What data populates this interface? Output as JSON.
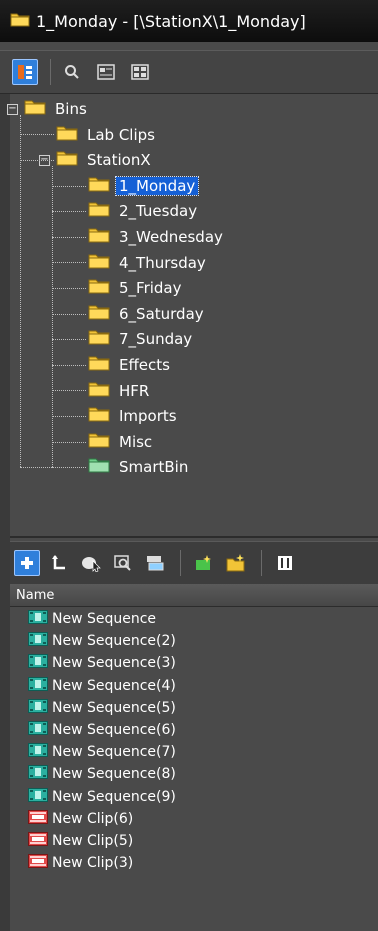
{
  "window": {
    "title": "1_Monday - [\\StationX\\1_Monday]"
  },
  "top_toolbar": {
    "buttons": [
      "bin-tree-view",
      "find",
      "bin-list-view",
      "bin-frame-view"
    ]
  },
  "tree": {
    "root": {
      "label": "Bins",
      "expanded": true
    },
    "items": [
      {
        "label": "Lab Clips",
        "level": 1,
        "icon": "folder-icon"
      },
      {
        "label": "StationX",
        "level": 1,
        "icon": "folder-icon",
        "expanded": true
      },
      {
        "label": "1_Monday",
        "level": 2,
        "icon": "folder-icon",
        "selected": true
      },
      {
        "label": "2_Tuesday",
        "level": 2,
        "icon": "folder-icon"
      },
      {
        "label": "3_Wednesday",
        "level": 2,
        "icon": "folder-icon"
      },
      {
        "label": "4_Thursday",
        "level": 2,
        "icon": "folder-icon"
      },
      {
        "label": "5_Friday",
        "level": 2,
        "icon": "folder-icon"
      },
      {
        "label": "6_Saturday",
        "level": 2,
        "icon": "folder-icon"
      },
      {
        "label": "7_Sunday",
        "level": 2,
        "icon": "folder-icon"
      },
      {
        "label": "Effects",
        "level": 2,
        "icon": "folder-icon"
      },
      {
        "label": "HFR",
        "level": 2,
        "icon": "folder-icon"
      },
      {
        "label": "Imports",
        "level": 2,
        "icon": "folder-icon"
      },
      {
        "label": "Misc",
        "level": 2,
        "icon": "folder-icon"
      },
      {
        "label": "SmartBin",
        "level": 2,
        "icon": "smart-bin-icon"
      }
    ]
  },
  "list": {
    "column_header": "Name",
    "rows": [
      {
        "label": "New Sequence",
        "icon": "sequence-icon"
      },
      {
        "label": "New Sequence(2)",
        "icon": "sequence-icon"
      },
      {
        "label": "New Sequence(3)",
        "icon": "sequence-icon"
      },
      {
        "label": "New Sequence(4)",
        "icon": "sequence-icon"
      },
      {
        "label": "New Sequence(5)",
        "icon": "sequence-icon"
      },
      {
        "label": "New Sequence(6)",
        "icon": "sequence-icon"
      },
      {
        "label": "New Sequence(7)",
        "icon": "sequence-icon"
      },
      {
        "label": "New Sequence(8)",
        "icon": "sequence-icon"
      },
      {
        "label": "New Sequence(9)",
        "icon": "sequence-icon"
      },
      {
        "label": "New Clip(6)",
        "icon": "clip-icon"
      },
      {
        "label": "New Clip(5)",
        "icon": "clip-icon"
      },
      {
        "label": "New Clip(3)",
        "icon": "clip-icon"
      }
    ]
  },
  "colors": {
    "background": "#4a4a4a",
    "selection": "#1560d6",
    "folder": "#f2c437",
    "sequence": "#2bb0a0",
    "clip": "#e14a4a"
  }
}
